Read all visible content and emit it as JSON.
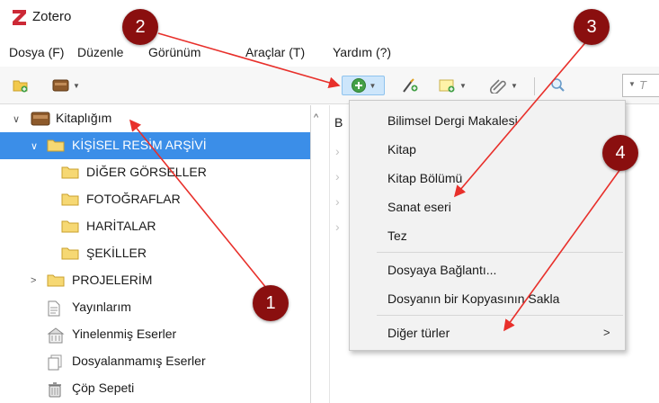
{
  "window": {
    "title": "Zotero",
    "logo_icon": "zotero-z-logo-icon",
    "accent_color": "#cc2936"
  },
  "menubar": {
    "items": [
      {
        "label": "Dosya (F)"
      },
      {
        "label": "Düzenle"
      },
      {
        "label": "Görünüm"
      },
      {
        "label": "Araçlar (T)"
      },
      {
        "label": "Yardım (?)"
      }
    ]
  },
  "toolbar": {
    "buttons": [
      {
        "icon": "new-collection-icon"
      },
      {
        "icon": "new-library-icon"
      },
      {
        "icon": "new-item-icon"
      },
      {
        "icon": "add-by-identifier-icon"
      },
      {
        "icon": "new-note-icon"
      },
      {
        "icon": "add-attachment-icon"
      },
      {
        "icon": "advanced-search-icon"
      }
    ],
    "search_placeholder": "T"
  },
  "sidebar": {
    "items": [
      {
        "label": "Kitaplığım",
        "icon": "library-icon",
        "level": 0,
        "twisty": "expanded"
      },
      {
        "label": "KİŞİSEL RESİM ARŞİVİ",
        "icon": "folder-icon",
        "level": 1,
        "twisty": "expanded",
        "selected": true
      },
      {
        "label": "DİĞER GÖRSELLER",
        "icon": "folder-icon",
        "level": 2
      },
      {
        "label": "FOTOĞRAFLAR",
        "icon": "folder-icon",
        "level": 2
      },
      {
        "label": "HARİTALAR",
        "icon": "folder-icon",
        "level": 2
      },
      {
        "label": "ŞEKİLLER",
        "icon": "folder-icon",
        "level": 2
      },
      {
        "label": "PROJELERİM",
        "icon": "folder-icon",
        "level": 1,
        "twisty": "collapsed"
      },
      {
        "label": "Yayınlarım",
        "icon": "document-icon",
        "level": 1
      },
      {
        "label": "Yinelenmiş Eserler",
        "icon": "duplicates-icon",
        "level": 1
      },
      {
        "label": "Dosyalanmamış Eserler",
        "icon": "unfiled-icon",
        "level": 1
      },
      {
        "label": "Çöp Sepeti",
        "icon": "trash-icon",
        "level": 1
      }
    ],
    "selection_color": "#3b8ee8"
  },
  "items_pane": {
    "column_header_partial": "B"
  },
  "dropdown": {
    "items": [
      {
        "label": "Bilimsel Dergi Makalesi"
      },
      {
        "label": "Kitap"
      },
      {
        "label": "Kitap Bölümü"
      },
      {
        "label": "Sanat eseri"
      },
      {
        "label": "Tez"
      },
      {
        "label": "Dosyaya Bağlantı..."
      },
      {
        "label": "Dosyanın bir Kopyasının Sakla"
      },
      {
        "label": "Diğer türler",
        "submenu": true
      }
    ]
  },
  "annotations": {
    "badges": [
      {
        "number": "1"
      },
      {
        "number": "2"
      },
      {
        "number": "3"
      },
      {
        "number": "4"
      }
    ],
    "arrow_color": "#e8302b",
    "badge_color": "#8a0f0f"
  }
}
